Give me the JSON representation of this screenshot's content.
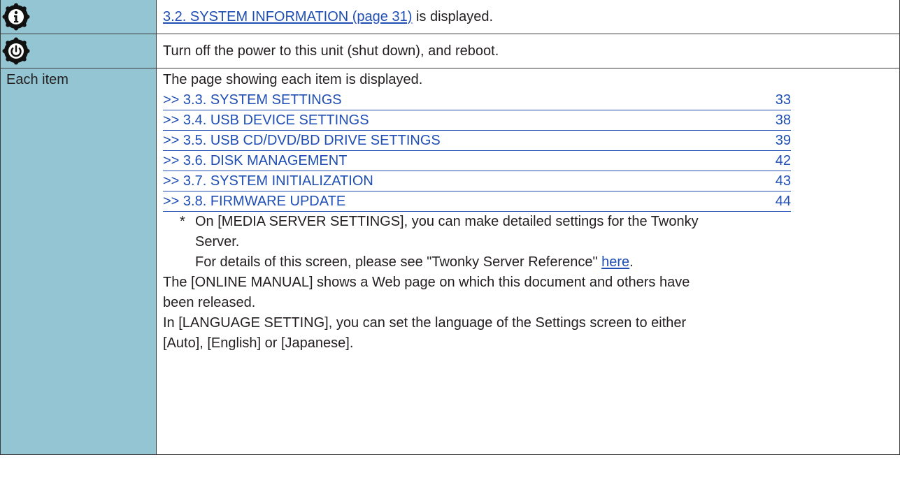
{
  "rows": {
    "info": {
      "icon": "info-icon",
      "link_text": "3.2. SYSTEM INFORMATION (page 31)",
      "suffix": " is displayed."
    },
    "power": {
      "icon": "power-icon",
      "text": "Turn off the power to this unit (shut down), and reboot."
    },
    "each": {
      "label": "Each item",
      "intro": "The page showing each item is displayed.",
      "toc": [
        {
          "title": ">> 3.3. SYSTEM SETTINGS",
          "page": "33"
        },
        {
          "title": ">> 3.4. USB DEVICE SETTINGS",
          "page": "38"
        },
        {
          "title": ">> 3.5. USB CD/DVD/BD DRIVE SETTINGS",
          "page": "39"
        },
        {
          "title": ">> 3.6. DISK MANAGEMENT",
          "page": "42"
        },
        {
          "title": ">> 3.7. SYSTEM INITIALIZATION",
          "page": "43"
        },
        {
          "title": ">> 3.8. FIRMWARE UPDATE",
          "page": "44"
        }
      ],
      "note_star": "*",
      "note_line1": "On [MEDIA SERVER SETTINGS], you can make detailed settings for the Twonky",
      "note_line2": "Server.",
      "note_line3_prefix": "For details of this screen, please see \"Twonky Server Reference\" ",
      "note_line3_link": "here",
      "note_line3_suffix": ".",
      "manual_line1": "The [ONLINE MANUAL] shows a Web page on which this document and others have",
      "manual_line2": "been released.",
      "language_line1": "In [LANGUAGE SETTING], you can set the language of the Settings screen to either",
      "language_line2": "[Auto], [English] or [Japanese]."
    }
  },
  "colors": {
    "left_column": "#93c5d2",
    "link": "#1f4eb4",
    "text": "#231f20",
    "border": "#3c3c3c"
  }
}
